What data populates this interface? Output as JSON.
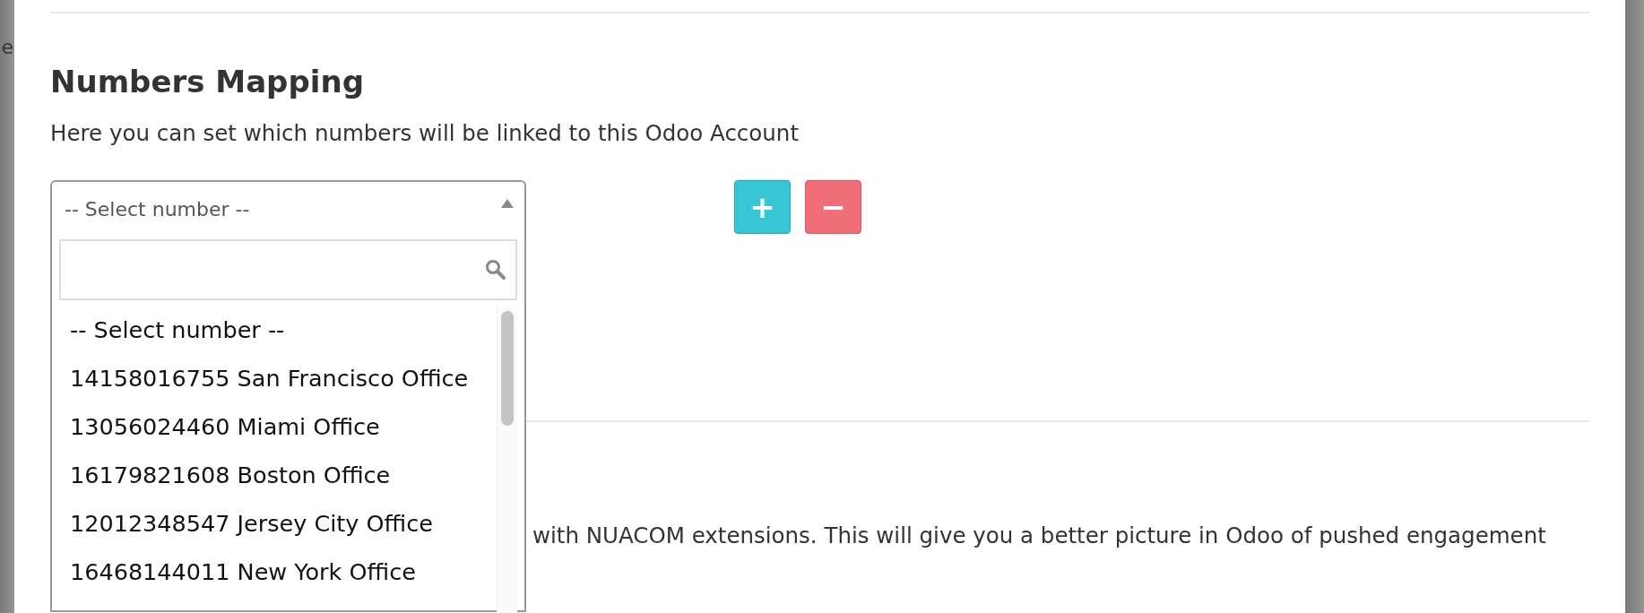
{
  "backdrop": {
    "left_fragments": [
      "e"
    ]
  },
  "section": {
    "title": "Numbers Mapping",
    "description": "Here you can set which numbers will be linked to this Odoo Account"
  },
  "number_select": {
    "value": "-- Select number --",
    "expanded": true,
    "options": [
      {
        "label": "-- Select number --"
      },
      {
        "label": "14158016755 San Francisco Office"
      },
      {
        "label": "13056024460 Miami Office"
      },
      {
        "label": "16179821608 Boston Office"
      },
      {
        "label": "12012348547 Jersey City Office"
      },
      {
        "label": "16468144011 New York Office"
      }
    ]
  },
  "buttons": [
    {
      "kind": "add",
      "label": "+"
    },
    {
      "kind": "remove",
      "label": "−"
    }
  ],
  "next_section": {
    "description_fragment": "with NUACOM extensions. This will give you a better picture in Odoo of pushed engagement"
  }
}
